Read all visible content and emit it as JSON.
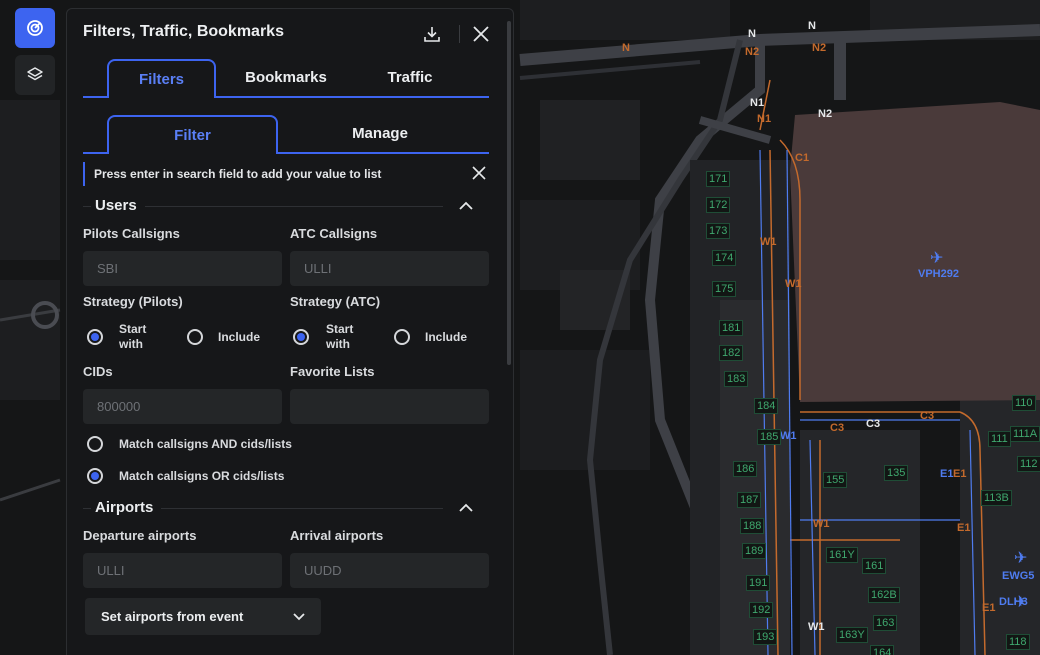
{
  "panel": {
    "title": "Filters, Traffic, Bookmarks",
    "tabs": [
      "Filters",
      "Bookmarks",
      "Traffic"
    ],
    "subtabs": [
      "Filter",
      "Manage"
    ],
    "info": "Press enter in search field to add your value to list"
  },
  "users": {
    "header": "Users",
    "pilots_callsigns_label": "Pilots Callsigns",
    "pilots_callsigns_placeholder": "SBI",
    "atc_callsigns_label": "ATC Callsigns",
    "atc_callsigns_placeholder": "ULLI",
    "strategy_pilots_label": "Strategy (Pilots)",
    "strategy_atc_label": "Strategy (ATC)",
    "start_with_line1": "Start",
    "start_with_line2": "with",
    "include": "Include",
    "cids_label": "CIDs",
    "cids_placeholder": "800000",
    "favorite_lists_label": "Favorite Lists",
    "favorite_lists_placeholder": "",
    "match_and": "Match callsigns AND cids/lists",
    "match_or": "Match callsigns OR cids/lists"
  },
  "airports": {
    "header": "Airports",
    "departure_label": "Departure airports",
    "departure_placeholder": "ULLI",
    "arrival_label": "Arrival airports",
    "arrival_placeholder": "UUDD",
    "set_from_event": "Set airports from event"
  },
  "map": {
    "taxi_labels": [
      "N",
      "N",
      "N",
      "N2",
      "N2",
      "N1",
      "N1",
      "N2",
      "C1",
      "W1",
      "W1",
      "W1",
      "C3",
      "C3",
      "C3",
      "E1",
      "E1",
      "W1",
      "E1",
      "E1",
      "W1"
    ],
    "stands": [
      "171",
      "172",
      "173",
      "174",
      "175",
      "181",
      "182",
      "183",
      "184",
      "185",
      "186",
      "187",
      "188",
      "189",
      "191",
      "192",
      "193",
      "155",
      "135",
      "161Y",
      "161",
      "162B",
      "163",
      "163Y",
      "164",
      "110",
      "111A",
      "111",
      "112",
      "113B",
      "118"
    ],
    "aircraft": [
      {
        "callsign": "VPH292"
      },
      {
        "callsign": "EWG5"
      },
      {
        "callsign": "DLH3"
      }
    ],
    "colors": {
      "taxi_orange": "#c46a2c",
      "taxi_blue": "#4f7cf0",
      "stand_green": "#3fa86e",
      "terminal": "#4a3a3a",
      "accent": "#3d64f0"
    }
  }
}
